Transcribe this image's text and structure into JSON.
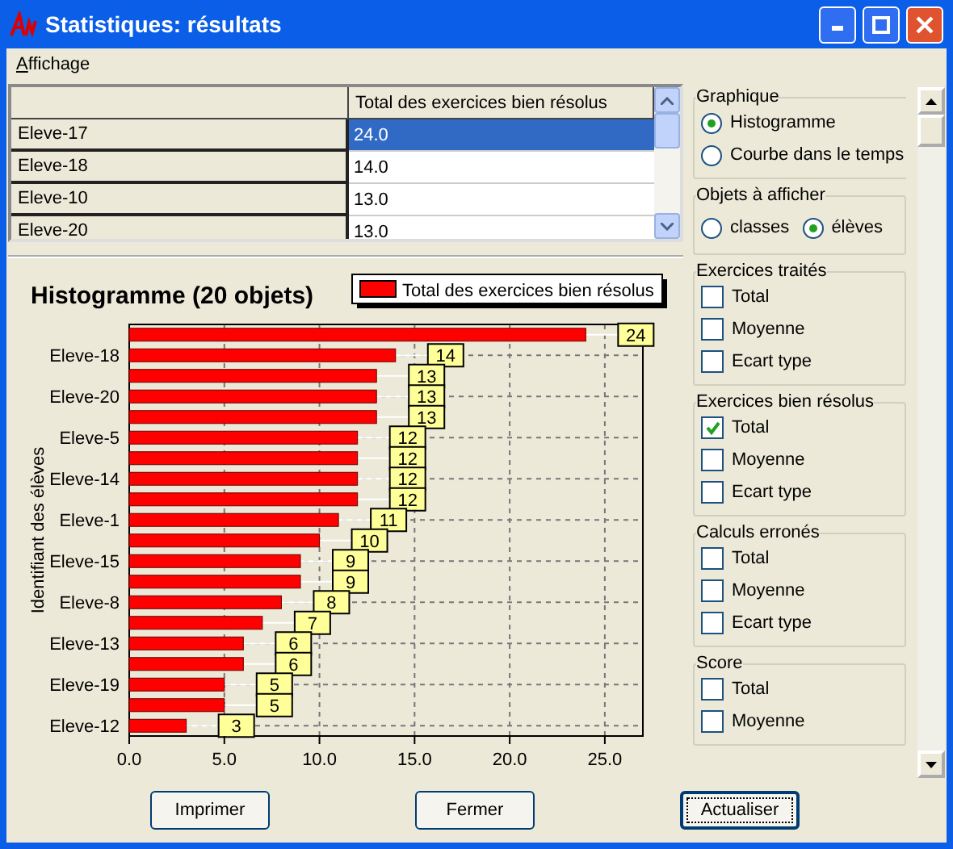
{
  "window": {
    "title": "Statistiques: résultats"
  },
  "menu": [
    {
      "label": "Affichage"
    }
  ],
  "table": {
    "columns": [
      "Total des exercices bien résolus"
    ],
    "rows": [
      {
        "name": "Eleve-17",
        "value": "24.0",
        "selected": true
      },
      {
        "name": "Eleve-18",
        "value": "14.0",
        "selected": false
      },
      {
        "name": "Eleve-10",
        "value": "13.0",
        "selected": false
      },
      {
        "name": "Eleve-20",
        "value": "13.0",
        "selected": false
      }
    ]
  },
  "chart": {
    "title": "Histogramme (20 objets)",
    "chart_data": {
      "type": "bar",
      "orientation": "horizontal",
      "ylabel": "Identifiant des élèves",
      "categories": [
        null,
        "Eleve-18",
        null,
        "Eleve-20",
        null,
        "Eleve-5",
        null,
        "Eleve-14",
        null,
        "Eleve-1",
        null,
        "Eleve-15",
        null,
        "Eleve-8",
        null,
        "Eleve-13",
        null,
        "Eleve-19",
        null,
        "Eleve-12"
      ],
      "series": [
        {
          "name": "Total des exercices bien résolus",
          "color": "#ff0000",
          "values": [
            24,
            14,
            13,
            13,
            13,
            12,
            12,
            12,
            12,
            11,
            10,
            9,
            9,
            8,
            7,
            6,
            6,
            5,
            5,
            3
          ]
        }
      ],
      "xlim": [
        0,
        27
      ],
      "xticks": [
        {
          "value": 0,
          "label": "0.0"
        },
        {
          "value": 5,
          "label": "5.0"
        },
        {
          "value": 10,
          "label": "10.0"
        },
        {
          "value": 15,
          "label": "15.0"
        },
        {
          "value": 20,
          "label": "20.0"
        },
        {
          "value": 25,
          "label": "25.0"
        }
      ],
      "data_labels": true,
      "grid": true
    }
  },
  "groups": [
    {
      "title": "Graphique",
      "kind": "radio-list",
      "items": [
        {
          "label": "Histogramme",
          "selected": true
        },
        {
          "label": "Courbe dans le temps",
          "selected": false
        }
      ]
    },
    {
      "title": "Objets à afficher",
      "kind": "radio-row",
      "items": [
        {
          "label": "classes",
          "selected": false
        },
        {
          "label": "élèves",
          "selected": true
        }
      ]
    },
    {
      "title": "Exercices traités",
      "kind": "checkbox-list",
      "items": [
        {
          "label": "Total",
          "checked": false
        },
        {
          "label": "Moyenne",
          "checked": false
        },
        {
          "label": "Ecart type",
          "checked": false
        }
      ]
    },
    {
      "title": "Exercices bien résolus",
      "kind": "checkbox-list",
      "items": [
        {
          "label": "Total",
          "checked": true
        },
        {
          "label": "Moyenne",
          "checked": false
        },
        {
          "label": "Ecart type",
          "checked": false
        }
      ]
    },
    {
      "title": "Calculs erronés",
      "kind": "checkbox-list",
      "items": [
        {
          "label": "Total",
          "checked": false
        },
        {
          "label": "Moyenne",
          "checked": false
        },
        {
          "label": "Ecart type",
          "checked": false
        }
      ]
    },
    {
      "title": "Score",
      "kind": "checkbox-list",
      "items": [
        {
          "label": "Total",
          "checked": false
        },
        {
          "label": "Moyenne",
          "checked": false
        }
      ]
    }
  ],
  "buttons": [
    {
      "label": "Imprimer",
      "default": false
    },
    {
      "label": "Fermer",
      "default": false
    },
    {
      "label": "Actualiser",
      "default": true
    }
  ]
}
